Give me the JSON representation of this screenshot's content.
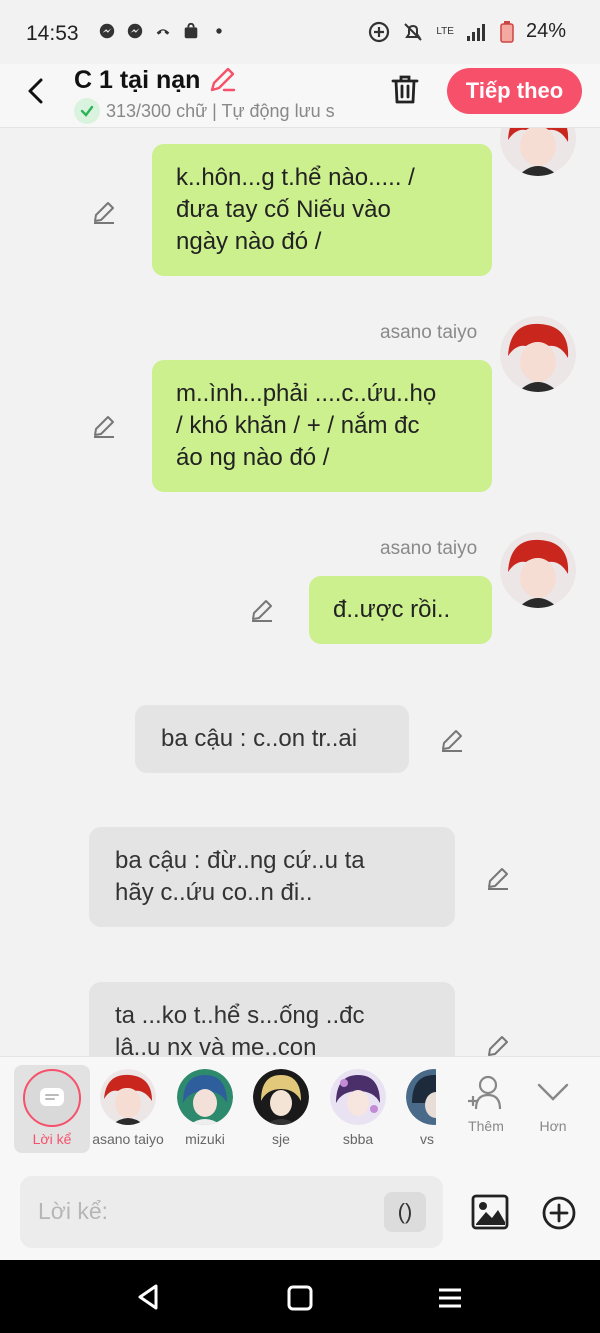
{
  "status": {
    "time": "14:53",
    "battery": "24%",
    "net": "LTE"
  },
  "header": {
    "title": "C 1 tại nạn",
    "subtitle": "313/300 chữ | Tự động lưu s",
    "next_label": "Tiếp theo"
  },
  "messages": [
    {
      "side": "right",
      "name": "",
      "text": "k..hôn...g t.hể nào.....  /\nđưa tay cố Niếu vào\nngày nào đó /"
    },
    {
      "side": "right",
      "name": "asano taiyo",
      "text": "m..ình...phải ....c..ứu..họ\n / khó khăn / + / nắm đc\náo ng nào đó /"
    },
    {
      "side": "right",
      "name": "asano taiyo",
      "text": "đ..ược rồi.."
    },
    {
      "side": "left",
      "name": "",
      "text": "ba cậu : c..on tr..ai"
    },
    {
      "side": "left",
      "name": "",
      "text": "ba cậu : đừ..ng cứ..u ta\nhãy c..ứu co..n đi.."
    },
    {
      "side": "left",
      "name": "",
      "text": "ta ...ko t..hể s...ống ..đc\nlâ..u nx và me..con"
    }
  ],
  "characters": [
    {
      "label": "Lời kể"
    },
    {
      "label": "asano taiyo"
    },
    {
      "label": "mizuki"
    },
    {
      "label": "sje"
    },
    {
      "label": "sbba"
    },
    {
      "label": "vs"
    }
  ],
  "actions": {
    "add_label": "Thêm",
    "more_label": "Hơn"
  },
  "composer": {
    "placeholder": "Lời kể:",
    "paren": "()"
  },
  "colors": {
    "accent": "#f7506a",
    "bubble_green": "#ccf08d",
    "bubble_grey": "#e4e4e4"
  }
}
